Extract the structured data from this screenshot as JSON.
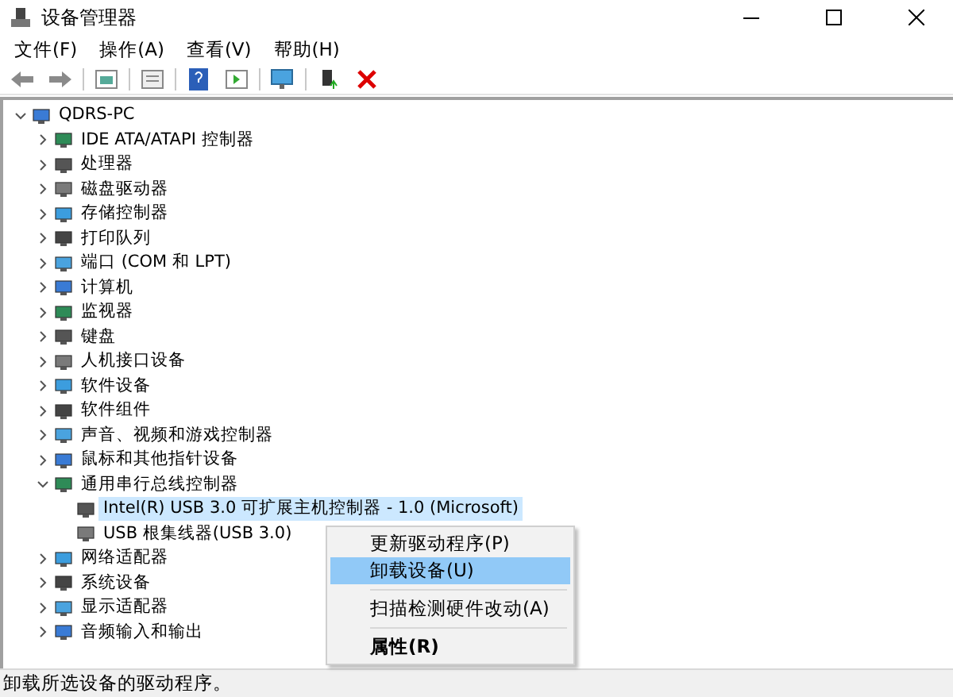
{
  "window": {
    "title": "设备管理器"
  },
  "menu_bar": [
    "文件(F)",
    "操作(A)",
    "查看(V)",
    "帮助(H)"
  ],
  "tree": [
    {
      "label": "QDRS-PC",
      "expanded": true,
      "selected": false,
      "children": [
        {
          "label": "IDE ATA/ATAPI 控制器",
          "expanded": false,
          "selected": false
        },
        {
          "label": "处理器",
          "expanded": false,
          "selected": false
        },
        {
          "label": "磁盘驱动器",
          "expanded": false,
          "selected": false
        },
        {
          "label": "存储控制器",
          "expanded": false,
          "selected": false
        },
        {
          "label": "打印队列",
          "expanded": false,
          "selected": false
        },
        {
          "label": "端口 (COM 和 LPT)",
          "expanded": false,
          "selected": false
        },
        {
          "label": "计算机",
          "expanded": false,
          "selected": false
        },
        {
          "label": "监视器",
          "expanded": false,
          "selected": false
        },
        {
          "label": "键盘",
          "expanded": false,
          "selected": false
        },
        {
          "label": "人机接口设备",
          "expanded": false,
          "selected": false
        },
        {
          "label": "软件设备",
          "expanded": false,
          "selected": false
        },
        {
          "label": "软件组件",
          "expanded": false,
          "selected": false
        },
        {
          "label": "声音、视频和游戏控制器",
          "expanded": false,
          "selected": false
        },
        {
          "label": "鼠标和其他指针设备",
          "expanded": false,
          "selected": false
        },
        {
          "label": "通用串行总线控制器",
          "expanded": true,
          "selected": false,
          "children": [
            {
              "label": "Intel(R) USB 3.0 可扩展主机控制器 - 1.0 (Microsoft)",
              "selected": true
            },
            {
              "label": "USB 根集线器(USB 3.0)",
              "selected": false
            }
          ]
        },
        {
          "label": "网络适配器",
          "expanded": false,
          "selected": false
        },
        {
          "label": "系统设备",
          "expanded": false,
          "selected": false
        },
        {
          "label": "显示适配器",
          "expanded": false,
          "selected": false
        },
        {
          "label": "音频输入和输出",
          "expanded": false,
          "selected": false
        }
      ]
    }
  ],
  "context_menu": [
    {
      "kind": "item",
      "label": "更新驱动程序(P)",
      "selected": false
    },
    {
      "kind": "item",
      "label": "卸载设备(U)",
      "selected": true
    },
    {
      "kind": "separator"
    },
    {
      "kind": "item",
      "label": "扫描检测硬件改动(A)",
      "selected": false
    },
    {
      "kind": "separator"
    },
    {
      "kind": "default",
      "label": "属性(R)",
      "selected": false
    }
  ],
  "status_bar": "卸载所选设备的驱动程序。"
}
